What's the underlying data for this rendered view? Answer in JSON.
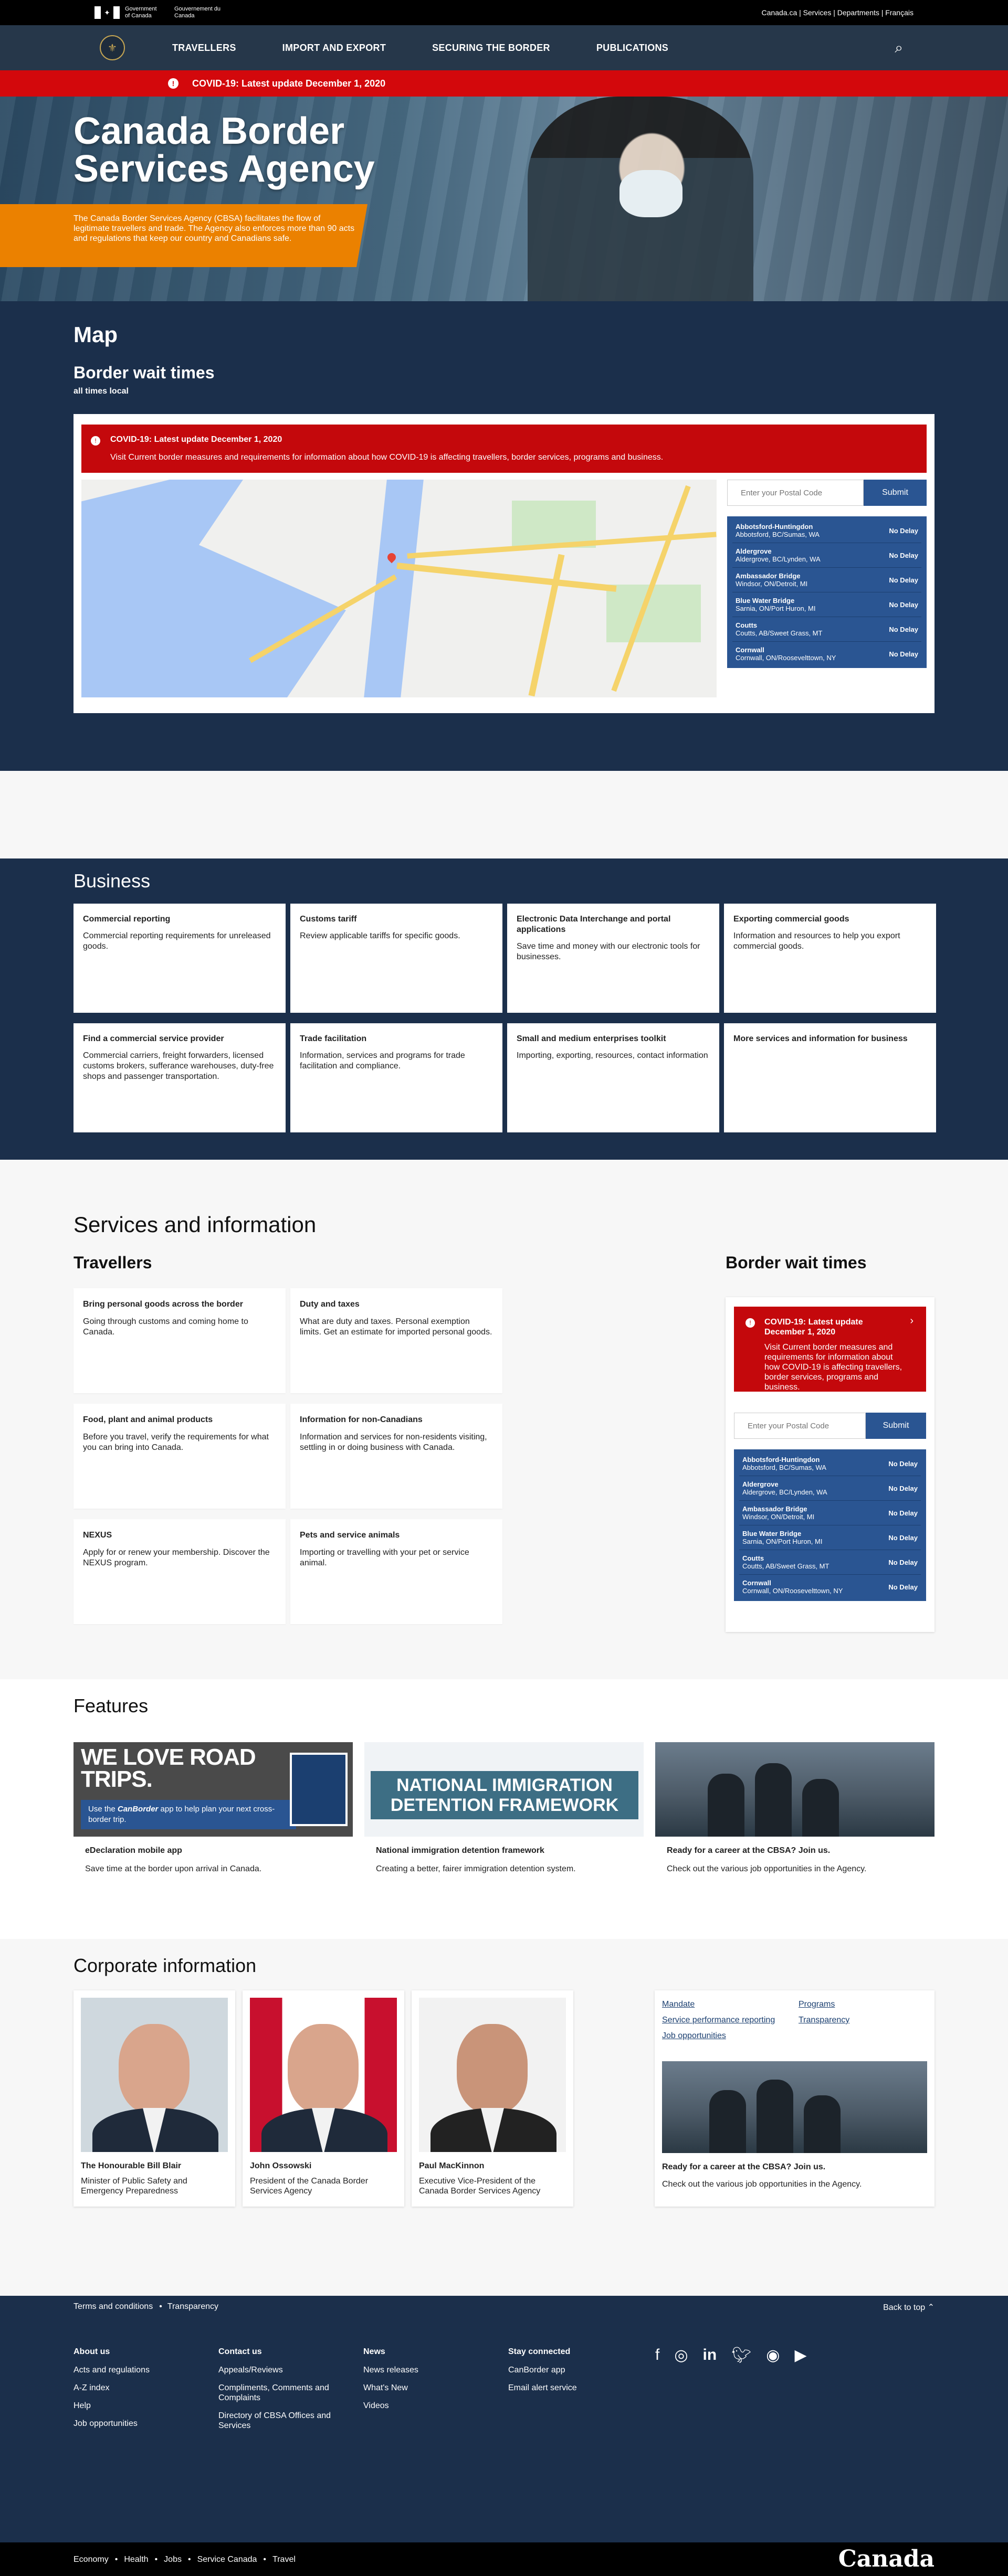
{
  "gc_bar": {
    "sig_en": "Government of Canada",
    "sig_fr": "Gouvernement du Canada",
    "links": "Canada.ca | Services | Departments | Français"
  },
  "nav": {
    "items": [
      "TRAVELLERS",
      "IMPORT AND EXPORT",
      "SECURING THE BORDER",
      "PUBLICATIONS"
    ],
    "search_icon": "search-icon"
  },
  "alert": {
    "text": "COVID-19: Latest update December 1, 2020"
  },
  "hero": {
    "title": "Canada Border Services Agency",
    "intro": "The Canada Border Services Agency (CBSA) facilitates the flow of legitimate travellers and trade. The Agency also enforces more than 90 acts and regulations that keep our country and Canadians safe."
  },
  "map_section": {
    "heading": "Map",
    "subheading": "Border wait times",
    "note": "all times local",
    "alert_title": "COVID-19: Latest update December 1, 2020",
    "alert_body": "Visit Current border measures and requirements for information about how COVID-19 is affecting travellers, border services, programs and business."
  },
  "wait_search": {
    "placeholder": "Enter your Postal Code",
    "submit": "Submit"
  },
  "crossings": [
    {
      "name": "Abbotsford-Huntingdon",
      "location": "Abbotsford, BC/Sumas, WA",
      "status": "No Delay"
    },
    {
      "name": "Aldergrove",
      "location": "Aldergrove, BC/Lynden, WA",
      "status": "No Delay"
    },
    {
      "name": "Ambassador Bridge",
      "location": "Windsor, ON/Detroit, MI",
      "status": "No Delay"
    },
    {
      "name": "Blue Water Bridge",
      "location": "Sarnia, ON/Port Huron, MI",
      "status": "No Delay"
    },
    {
      "name": "Coutts",
      "location": "Coutts, AB/Sweet Grass, MT",
      "status": "No Delay"
    },
    {
      "name": "Cornwall",
      "location": "Cornwall, ON/Roosevelttown, NY",
      "status": "No Delay"
    }
  ],
  "business": {
    "heading": "Business",
    "cards": [
      {
        "title": "Commercial reporting",
        "desc": "Commercial reporting requirements for unreleased goods."
      },
      {
        "title": "Customs tariff",
        "desc": "Review applicable tariffs for specific goods."
      },
      {
        "title": "Electronic Data Interchange and portal applications",
        "desc": "Save time and money with our electronic tools for businesses."
      },
      {
        "title": "Exporting commercial goods",
        "desc": "Information and resources to help you export commercial goods."
      },
      {
        "title": "Find a commercial service provider",
        "desc": "Commercial carriers, freight forwarders, licensed customs brokers, sufferance warehouses, duty-free shops and passenger transportation."
      },
      {
        "title": "Trade facilitation",
        "desc": "Information, services and programs for trade facilitation and compliance."
      },
      {
        "title": "Small and medium enterprises toolkit",
        "desc": "Importing, exporting, resources, contact information"
      },
      {
        "title": "More services and information for business",
        "desc": ""
      }
    ]
  },
  "services": {
    "heading": "Services and information",
    "travellers_heading": "Travellers",
    "bwt_heading": "Border wait times",
    "cards": [
      {
        "title": "Bring personal goods across the border",
        "desc": "Going through customs and coming home to Canada."
      },
      {
        "title": "Duty and taxes",
        "desc": "What are duty and taxes. Personal exemption limits. Get an estimate for imported personal goods."
      },
      {
        "title": "Food, plant and animal products",
        "desc": "Before you travel, verify the requirements for what you can bring into Canada."
      },
      {
        "title": "Information for non-Canadians",
        "desc": "Information and services for non-residents visiting, settling in or doing business with Canada."
      },
      {
        "title": "NEXUS",
        "desc": "Apply for or renew your membership. Discover the NEXUS program."
      },
      {
        "title": "Pets and service animals",
        "desc": "Importing or travelling with your pet or service animal."
      }
    ],
    "side_alert_title": "COVID-19: Latest update December 1, 2020",
    "side_alert_body": "Visit Current border measures and requirements for information about how COVID-19 is affecting travellers, border services, programs and business."
  },
  "features": {
    "heading": "Features",
    "roadtrip_big": "WE LOVE ROAD TRIPS.",
    "roadtrip_pre": "Use the ",
    "roadtrip_app": "CanBorder",
    "roadtrip_post": " app to help plan your next cross-border trip.",
    "nidf_banner": "NATIONAL IMMIGRATION DETENTION FRAMEWORK",
    "items": [
      {
        "title": "eDeclaration mobile app",
        "desc": "Save time at the border upon arrival in Canada."
      },
      {
        "title": "National immigration detention framework",
        "desc": "Creating a better, fairer immigration detention system."
      },
      {
        "title": "Ready for a career at the CBSA? Join us.",
        "desc": "Check out the various job opportunities in the Agency."
      }
    ]
  },
  "corporate": {
    "heading": "Corporate information",
    "people": [
      {
        "name": "The Honourable Bill Blair",
        "role": "Minister of Public Safety and Emergency Preparedness"
      },
      {
        "name": "John Ossowski",
        "role": "President of the Canada Border Services Agency"
      },
      {
        "name": "Paul MacKinnon",
        "role": "Executive Vice-President of the Canada Border Services Agency"
      }
    ],
    "links": [
      "Mandate",
      "Programs",
      "Service performance reporting",
      "Transparency",
      "Job opportunities"
    ],
    "career_title": "Ready for a career at the CBSA? Join us.",
    "career_desc": "Check out the various job opportunities in the Agency."
  },
  "footer": {
    "top_links": [
      "Terms and conditions",
      "Transparency"
    ],
    "back_to_top": "Back to top",
    "columns": [
      {
        "heading": "About us",
        "links": [
          "Acts and regulations",
          "A-Z index",
          "Help",
          "Job opportunities"
        ]
      },
      {
        "heading": "Contact us",
        "links": [
          "Appeals/Reviews",
          "Compliments, Comments and Complaints",
          "Directory of CBSA Offices and Services"
        ]
      },
      {
        "heading": "News",
        "links": [
          "News releases",
          "What's New",
          "Videos"
        ]
      },
      {
        "heading": "Stay connected",
        "links": [
          "CanBorder app",
          "Email alert service"
        ]
      }
    ],
    "social_icons": [
      "facebook-icon",
      "instagram-icon",
      "linkedin-icon",
      "twitter-icon",
      "rss-icon",
      "youtube-icon"
    ],
    "bottom_links": [
      "Economy",
      "Health",
      "Jobs",
      "Service Canada",
      "Travel"
    ],
    "wordmark": "Canada"
  }
}
